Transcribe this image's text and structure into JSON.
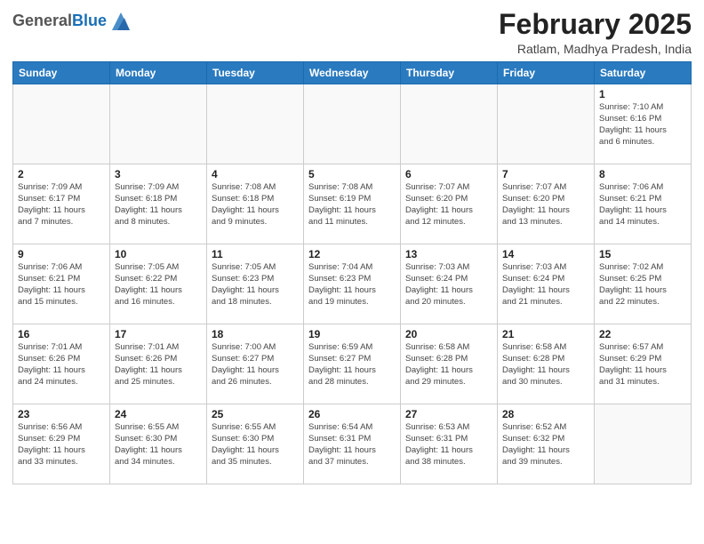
{
  "header": {
    "logo": {
      "general": "General",
      "blue": "Blue"
    },
    "month_year": "February 2025",
    "location": "Ratlam, Madhya Pradesh, India"
  },
  "weekdays": [
    "Sunday",
    "Monday",
    "Tuesday",
    "Wednesday",
    "Thursday",
    "Friday",
    "Saturday"
  ],
  "weeks": [
    [
      {
        "day": "",
        "info": ""
      },
      {
        "day": "",
        "info": ""
      },
      {
        "day": "",
        "info": ""
      },
      {
        "day": "",
        "info": ""
      },
      {
        "day": "",
        "info": ""
      },
      {
        "day": "",
        "info": ""
      },
      {
        "day": "1",
        "info": "Sunrise: 7:10 AM\nSunset: 6:16 PM\nDaylight: 11 hours\nand 6 minutes."
      }
    ],
    [
      {
        "day": "2",
        "info": "Sunrise: 7:09 AM\nSunset: 6:17 PM\nDaylight: 11 hours\nand 7 minutes."
      },
      {
        "day": "3",
        "info": "Sunrise: 7:09 AM\nSunset: 6:18 PM\nDaylight: 11 hours\nand 8 minutes."
      },
      {
        "day": "4",
        "info": "Sunrise: 7:08 AM\nSunset: 6:18 PM\nDaylight: 11 hours\nand 9 minutes."
      },
      {
        "day": "5",
        "info": "Sunrise: 7:08 AM\nSunset: 6:19 PM\nDaylight: 11 hours\nand 11 minutes."
      },
      {
        "day": "6",
        "info": "Sunrise: 7:07 AM\nSunset: 6:20 PM\nDaylight: 11 hours\nand 12 minutes."
      },
      {
        "day": "7",
        "info": "Sunrise: 7:07 AM\nSunset: 6:20 PM\nDaylight: 11 hours\nand 13 minutes."
      },
      {
        "day": "8",
        "info": "Sunrise: 7:06 AM\nSunset: 6:21 PM\nDaylight: 11 hours\nand 14 minutes."
      }
    ],
    [
      {
        "day": "9",
        "info": "Sunrise: 7:06 AM\nSunset: 6:21 PM\nDaylight: 11 hours\nand 15 minutes."
      },
      {
        "day": "10",
        "info": "Sunrise: 7:05 AM\nSunset: 6:22 PM\nDaylight: 11 hours\nand 16 minutes."
      },
      {
        "day": "11",
        "info": "Sunrise: 7:05 AM\nSunset: 6:23 PM\nDaylight: 11 hours\nand 18 minutes."
      },
      {
        "day": "12",
        "info": "Sunrise: 7:04 AM\nSunset: 6:23 PM\nDaylight: 11 hours\nand 19 minutes."
      },
      {
        "day": "13",
        "info": "Sunrise: 7:03 AM\nSunset: 6:24 PM\nDaylight: 11 hours\nand 20 minutes."
      },
      {
        "day": "14",
        "info": "Sunrise: 7:03 AM\nSunset: 6:24 PM\nDaylight: 11 hours\nand 21 minutes."
      },
      {
        "day": "15",
        "info": "Sunrise: 7:02 AM\nSunset: 6:25 PM\nDaylight: 11 hours\nand 22 minutes."
      }
    ],
    [
      {
        "day": "16",
        "info": "Sunrise: 7:01 AM\nSunset: 6:26 PM\nDaylight: 11 hours\nand 24 minutes."
      },
      {
        "day": "17",
        "info": "Sunrise: 7:01 AM\nSunset: 6:26 PM\nDaylight: 11 hours\nand 25 minutes."
      },
      {
        "day": "18",
        "info": "Sunrise: 7:00 AM\nSunset: 6:27 PM\nDaylight: 11 hours\nand 26 minutes."
      },
      {
        "day": "19",
        "info": "Sunrise: 6:59 AM\nSunset: 6:27 PM\nDaylight: 11 hours\nand 28 minutes."
      },
      {
        "day": "20",
        "info": "Sunrise: 6:58 AM\nSunset: 6:28 PM\nDaylight: 11 hours\nand 29 minutes."
      },
      {
        "day": "21",
        "info": "Sunrise: 6:58 AM\nSunset: 6:28 PM\nDaylight: 11 hours\nand 30 minutes."
      },
      {
        "day": "22",
        "info": "Sunrise: 6:57 AM\nSunset: 6:29 PM\nDaylight: 11 hours\nand 31 minutes."
      }
    ],
    [
      {
        "day": "23",
        "info": "Sunrise: 6:56 AM\nSunset: 6:29 PM\nDaylight: 11 hours\nand 33 minutes."
      },
      {
        "day": "24",
        "info": "Sunrise: 6:55 AM\nSunset: 6:30 PM\nDaylight: 11 hours\nand 34 minutes."
      },
      {
        "day": "25",
        "info": "Sunrise: 6:55 AM\nSunset: 6:30 PM\nDaylight: 11 hours\nand 35 minutes."
      },
      {
        "day": "26",
        "info": "Sunrise: 6:54 AM\nSunset: 6:31 PM\nDaylight: 11 hours\nand 37 minutes."
      },
      {
        "day": "27",
        "info": "Sunrise: 6:53 AM\nSunset: 6:31 PM\nDaylight: 11 hours\nand 38 minutes."
      },
      {
        "day": "28",
        "info": "Sunrise: 6:52 AM\nSunset: 6:32 PM\nDaylight: 11 hours\nand 39 minutes."
      },
      {
        "day": "",
        "info": ""
      }
    ]
  ]
}
